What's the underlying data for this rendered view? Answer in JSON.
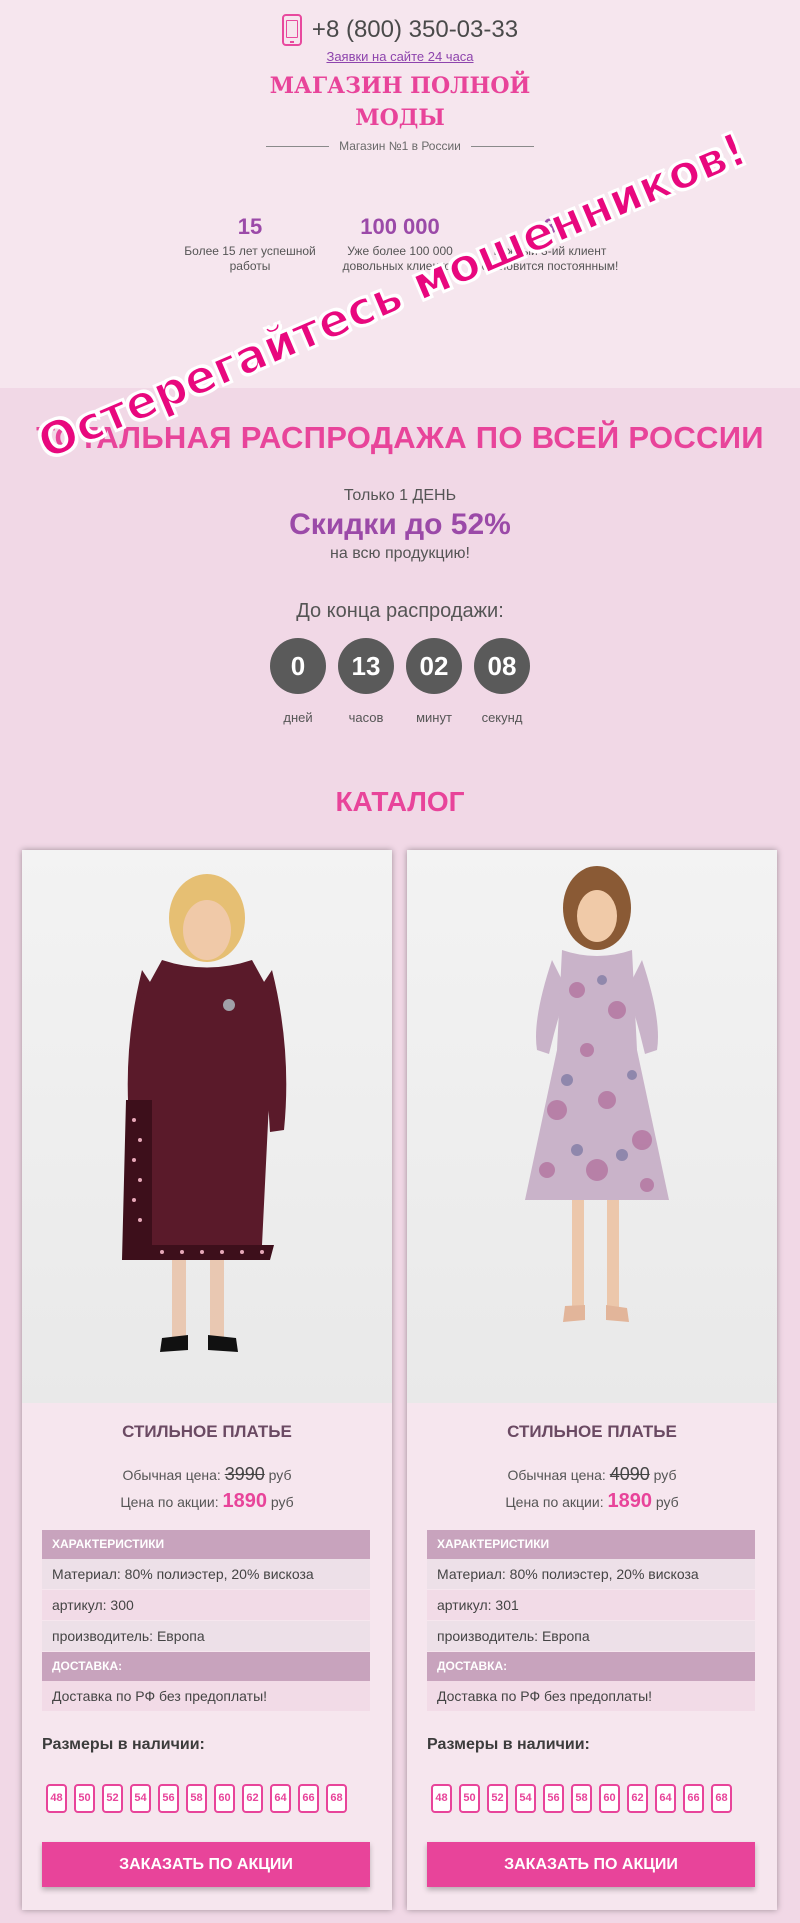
{
  "header": {
    "phone": "+8 (800) 350-03-33",
    "requests": "Заявки на сайте 24 часа",
    "shop_title": "МАГАЗИН ПОЛНОЙ МОДЫ",
    "subtitle": "Магазин №1 в России"
  },
  "stats": [
    {
      "num": "15",
      "text": "Более 15 лет успешной работы"
    },
    {
      "num": "100 000",
      "text": "Уже более 100 000 довольных клиентов"
    },
    {
      "num": "3",
      "text": "Каждый 3-ий клиент становится постоянным!"
    }
  ],
  "sale": {
    "title": "ТОТАЛЬНАЯ РАСПРОДАЖА ПО ВСЕЙ РОССИИ",
    "only_day": "Только 1 ДЕНЬ",
    "discount": "Скидки до 52%",
    "for_all": "на всю продукцию!",
    "until_end": "До конца распродажи:",
    "timer": [
      {
        "value": "0",
        "label": "дней"
      },
      {
        "value": "13",
        "label": "часов"
      },
      {
        "value": "02",
        "label": "минут"
      },
      {
        "value": "08",
        "label": "секунд"
      }
    ]
  },
  "catalog_title": "КАТАЛОГ",
  "products": [
    {
      "name": "СТИЛЬНОЕ ПЛАТЬЕ",
      "old_label": "Обычная цена:",
      "old_price": "3990",
      "new_label": "Цена по акции:",
      "new_price": "1890",
      "currency": "руб",
      "char_head": "ХАРАКТЕРИСТИКИ",
      "material": "Материал: 80% полиэстер, 20% вискоза",
      "article": "артикул: 300",
      "maker": "производитель: Европа",
      "delivery_head": "ДОСТАВКА:",
      "delivery": "Доставка по РФ без предоплаты!",
      "sizes_title": "Размеры в наличии:",
      "sizes": [
        "48",
        "50",
        "52",
        "54",
        "56",
        "58",
        "60",
        "62",
        "64",
        "66",
        "68"
      ],
      "button": "ЗАКАЗАТЬ ПО АКЦИИ",
      "colors": {
        "dress": "#5a1a2a"
      }
    },
    {
      "name": "СТИЛЬНОЕ ПЛАТЬЕ",
      "old_label": "Обычная цена:",
      "old_price": "4090",
      "new_label": "Цена по акции:",
      "new_price": "1890",
      "currency": "руб",
      "char_head": "ХАРАКТЕРИСТИКИ",
      "material": "Материал: 80% полиэстер, 20% вискоза",
      "article": "артикул: 301",
      "maker": "производитель: Европа",
      "delivery_head": "ДОСТАВКА:",
      "delivery": "Доставка по РФ без предоплаты!",
      "sizes_title": "Размеры в наличии:",
      "sizes": [
        "48",
        "50",
        "52",
        "54",
        "56",
        "58",
        "60",
        "62",
        "64",
        "66",
        "68"
      ],
      "button": "ЗАКАЗАТЬ ПО АКЦИИ",
      "colors": {
        "dress": "#c9b3c9"
      }
    }
  ],
  "overlay_text": "Остерегайтесь мошенников!",
  "colors": {
    "accent": "#e8449a",
    "purple": "#9b4aa8",
    "bg": "#f1d8e6"
  }
}
